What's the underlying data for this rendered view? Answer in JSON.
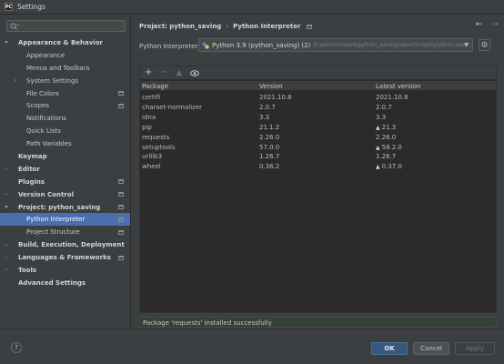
{
  "window": {
    "title": "Settings",
    "app_icon": "PC"
  },
  "search": {
    "placeholder": "",
    "value": ""
  },
  "sidebar": {
    "items": [
      {
        "label": "Appearance & Behavior",
        "level": 0,
        "expanded": true,
        "bold": true,
        "icon": false,
        "selected": false
      },
      {
        "label": "Appearance",
        "level": 1,
        "bold": false,
        "icon": false,
        "selected": false
      },
      {
        "label": "Menus and Toolbars",
        "level": 1,
        "bold": false,
        "icon": false,
        "selected": false
      },
      {
        "label": "System Settings",
        "level": 1,
        "expanded": false,
        "bold": false,
        "icon": false,
        "selected": false
      },
      {
        "label": "File Colors",
        "level": 1,
        "bold": false,
        "icon": true,
        "selected": false
      },
      {
        "label": "Scopes",
        "level": 1,
        "bold": false,
        "icon": true,
        "selected": false
      },
      {
        "label": "Notifications",
        "level": 1,
        "bold": false,
        "icon": false,
        "selected": false
      },
      {
        "label": "Quick Lists",
        "level": 1,
        "bold": false,
        "icon": false,
        "selected": false
      },
      {
        "label": "Path Variables",
        "level": 1,
        "bold": false,
        "icon": false,
        "selected": false
      },
      {
        "label": "Keymap",
        "level": 0,
        "bold": true,
        "icon": false,
        "selected": false
      },
      {
        "label": "Editor",
        "level": 0,
        "expanded": false,
        "bold": true,
        "icon": false,
        "selected": false
      },
      {
        "label": "Plugins",
        "level": 0,
        "bold": true,
        "icon": true,
        "selected": false
      },
      {
        "label": "Version Control",
        "level": 0,
        "expanded": false,
        "bold": true,
        "icon": true,
        "selected": false
      },
      {
        "label": "Project: python_saving",
        "level": 0,
        "expanded": true,
        "bold": true,
        "icon": true,
        "selected": false
      },
      {
        "label": "Python Interpreter",
        "level": 1,
        "bold": false,
        "icon": true,
        "selected": true
      },
      {
        "label": "Project Structure",
        "level": 1,
        "bold": false,
        "icon": true,
        "selected": false
      },
      {
        "label": "Build, Execution, Deployment",
        "level": 0,
        "expanded": false,
        "bold": true,
        "icon": false,
        "selected": false
      },
      {
        "label": "Languages & Frameworks",
        "level": 0,
        "expanded": false,
        "bold": true,
        "icon": true,
        "selected": false
      },
      {
        "label": "Tools",
        "level": 0,
        "expanded": false,
        "bold": true,
        "icon": false,
        "selected": false
      },
      {
        "label": "Advanced Settings",
        "level": 0,
        "bold": true,
        "icon": false,
        "selected": false
      }
    ]
  },
  "breadcrumb": {
    "project": "Project: python_saving",
    "separator": "›",
    "page": "Python Interpreter"
  },
  "interpreter": {
    "label": "Python Interpreter:",
    "name": "Python 3.9 (python_saving) (2)",
    "path": "D:\\environment\\python_saving\\venv\\Scripts\\python.exe"
  },
  "toolbar": {
    "add": "+",
    "remove": "−",
    "upgrade": "▲"
  },
  "table": {
    "columns": [
      "Package",
      "Version",
      "Latest version"
    ],
    "rows": [
      {
        "package": "certifi",
        "version": "2021.10.8",
        "latest": "2021.10.8",
        "upgrade": false
      },
      {
        "package": "charset-normalizer",
        "version": "2.0.7",
        "latest": "2.0.7",
        "upgrade": false
      },
      {
        "package": "idna",
        "version": "3.3",
        "latest": "3.3",
        "upgrade": false
      },
      {
        "package": "pip",
        "version": "21.1.2",
        "latest": "21.3",
        "upgrade": true
      },
      {
        "package": "requests",
        "version": "2.26.0",
        "latest": "2.26.0",
        "upgrade": false
      },
      {
        "package": "setuptools",
        "version": "57.0.0",
        "latest": "58.2.0",
        "upgrade": true
      },
      {
        "package": "urllib3",
        "version": "1.26.7",
        "latest": "1.26.7",
        "upgrade": false
      },
      {
        "package": "wheel",
        "version": "0.36.2",
        "latest": "0.37.0",
        "upgrade": true
      }
    ]
  },
  "status": {
    "message": "Package 'requests' installed successfully"
  },
  "footer": {
    "help": "?",
    "ok": "OK",
    "cancel": "Cancel",
    "apply": "Apply"
  },
  "colors": {
    "background": "#3c3f41",
    "selection": "#4b6eaf",
    "table_bg": "#2b2b2b",
    "status_bg": "#344134",
    "ok_button": "#365880"
  }
}
